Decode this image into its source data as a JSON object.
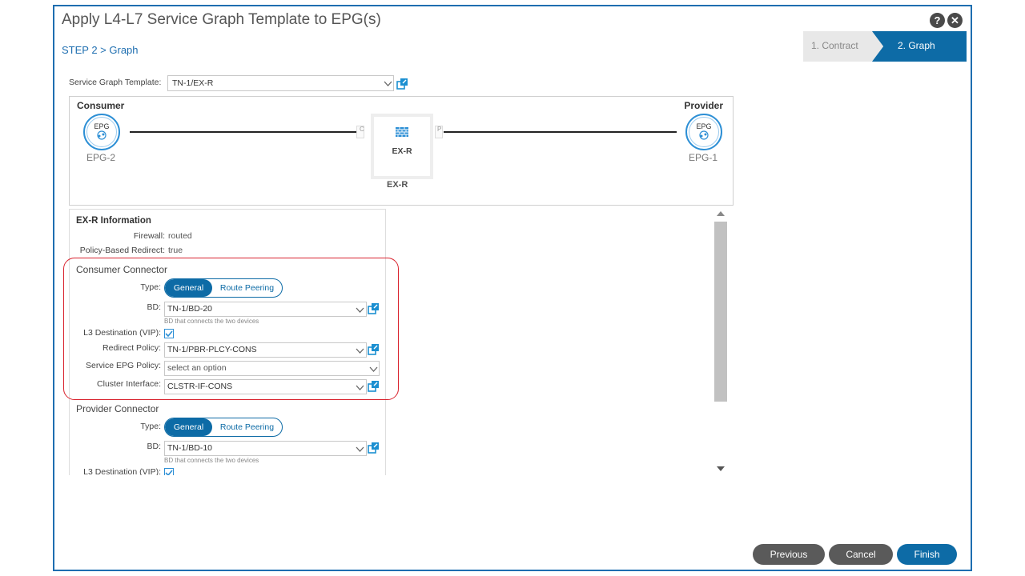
{
  "dialog": {
    "title": "Apply L4-L7 Service Graph Template to EPG(s)",
    "breadcrumb": "STEP 2 > Graph",
    "help_icon": "question-icon",
    "close_icon": "close-icon"
  },
  "wizard": {
    "steps": [
      {
        "label": "1. Contract",
        "active": false
      },
      {
        "label": "2. Graph",
        "active": true
      }
    ]
  },
  "template": {
    "label": "Service Graph Template:",
    "value": "TN-1/EX-R"
  },
  "graph": {
    "consumer_label": "Consumer",
    "provider_label": "Provider",
    "consumer_epg": {
      "badge": "EPG",
      "name": "EPG-2"
    },
    "provider_epg": {
      "badge": "EPG",
      "name": "EPG-1"
    },
    "port_c": "C",
    "port_p": "P",
    "device": {
      "name": "EX-R",
      "label_below": "EX-R"
    }
  },
  "info": {
    "title": "EX-R Information",
    "firewall_label": "Firewall:",
    "firewall_value": "routed",
    "pbr_label": "Policy-Based Redirect:",
    "pbr_value": "true"
  },
  "consumer_connector": {
    "title": "Consumer Connector",
    "type_label": "Type:",
    "type_options": [
      "General",
      "Route Peering"
    ],
    "bd_label": "BD:",
    "bd_value": "TN-1/BD-20",
    "bd_hint": "BD that connects the two devices",
    "l3_label": "L3 Destination (VIP):",
    "l3_checked": true,
    "redirect_label": "Redirect Policy:",
    "redirect_value": "TN-1/PBR-PLCY-CONS",
    "sepg_label": "Service EPG Policy:",
    "sepg_placeholder": "select an option",
    "cluster_label": "Cluster Interface:",
    "cluster_value": "CLSTR-IF-CONS"
  },
  "provider_connector": {
    "title": "Provider Connector",
    "type_label": "Type:",
    "type_options": [
      "General",
      "Route Peering"
    ],
    "bd_label": "BD:",
    "bd_value": "TN-1/BD-10",
    "bd_hint": "BD that connects the two devices",
    "l3_label": "L3 Destination (VIP):",
    "l3_checked": true
  },
  "buttons": {
    "previous": "Previous",
    "cancel": "Cancel",
    "finish": "Finish"
  },
  "colors": {
    "accent": "#0d6ba6",
    "dialog_border": "#1e6eb0",
    "highlight": "#d9232e",
    "secondary_button": "#5a5a5a"
  }
}
